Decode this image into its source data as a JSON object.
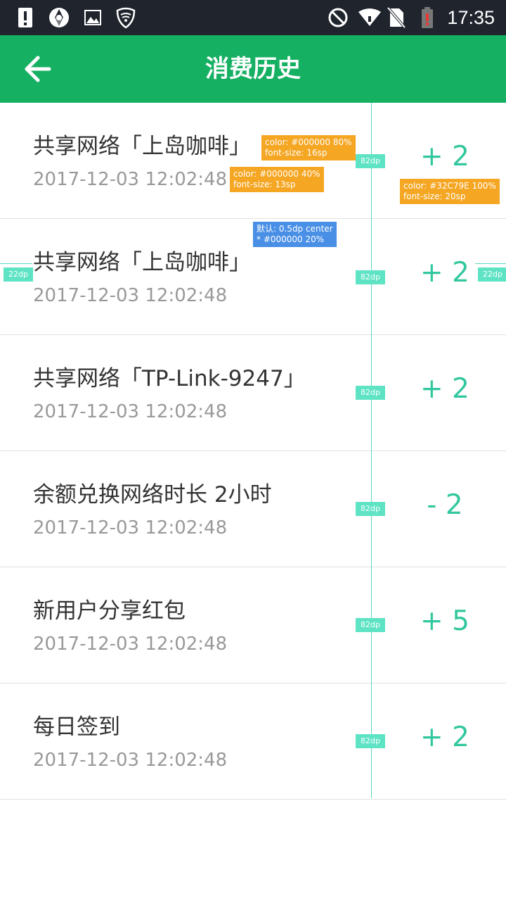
{
  "status_bar": {
    "time": "17:35"
  },
  "header": {
    "title": "消费历史"
  },
  "items": [
    {
      "title": "共享网络「上岛咖啡」",
      "time": "2017-12-03 12:02:48",
      "amount": "+ 2"
    },
    {
      "title": "共享网络「上岛咖啡」",
      "time": "2017-12-03 12:02:48",
      "amount": "+ 2"
    },
    {
      "title": "共享网络「TP-Link-9247」",
      "time": "2017-12-03 12:02:48",
      "amount": "+ 2"
    },
    {
      "title": "余额兑换网络时长 2小时",
      "time": "2017-12-03 12:02:48",
      "amount": "- 2"
    },
    {
      "title": "新用户分享红包",
      "time": "2017-12-03 12:02:48",
      "amount": "+ 5"
    },
    {
      "title": "每日签到",
      "time": "2017-12-03 12:02:48",
      "amount": "+ 2"
    }
  ],
  "annotations": {
    "title_spec": "color: #000000 80%\nfont-size: 16sp",
    "time_spec": "color: #000000 40%\nfont-size: 13sp",
    "amount_spec": "color: #32C79E 100%\nfont-size: 20sp",
    "divider_spec": "默认: 0.5dp center\n* #000000 20%",
    "amount_gap": "82dp",
    "margin": "22dp"
  },
  "colors": {
    "primary": "#16b063",
    "accent": "#32c79e",
    "status_bar": "#1f242d"
  },
  "icons": {
    "status": [
      "alert-icon",
      "sync-icon",
      "image-icon",
      "shield-icon",
      "block-icon",
      "wifi-icon",
      "no-sim-icon",
      "battery-icon"
    ],
    "back": "arrow-left-icon"
  }
}
